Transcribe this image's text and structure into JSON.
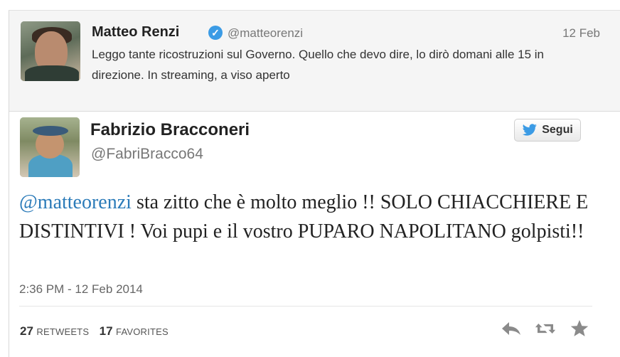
{
  "reply_to": {
    "name": "Matteo Renzi",
    "handle": "@matteorenzi",
    "date": "12 Feb",
    "text": "Leggo tante ricostruzioni sul Governo. Quello che devo dire, lo dirò domani alle 15 in direzione. In streaming, a viso aperto",
    "verified_badge": "✓"
  },
  "tweet": {
    "name": "Fabrizio Bracconeri",
    "handle": "@FabriBracco64",
    "follow_label": "Segui",
    "mention": "@matteorenzi",
    "text": " sta zitto che è molto meglio !! SOLO CHIACCHIERE E DISTINTIVI ! Voi pupi e il vostro PUPARO NAPOLITANO golpisti!!",
    "timestamp": "2:36 PM - 12 Feb 2014",
    "retweets_count": "27",
    "retweets_label": "RETWEETS",
    "favorites_count": "17",
    "favorites_label": "FAVORITES"
  },
  "icons": {
    "follow": "bird-icon",
    "reply": "reply-icon",
    "retweet": "retweet-icon",
    "favorite": "star-icon"
  },
  "colors": {
    "link": "#2b7bb9",
    "verified": "#3b9be5",
    "icon_gray": "#8a8a8a"
  }
}
